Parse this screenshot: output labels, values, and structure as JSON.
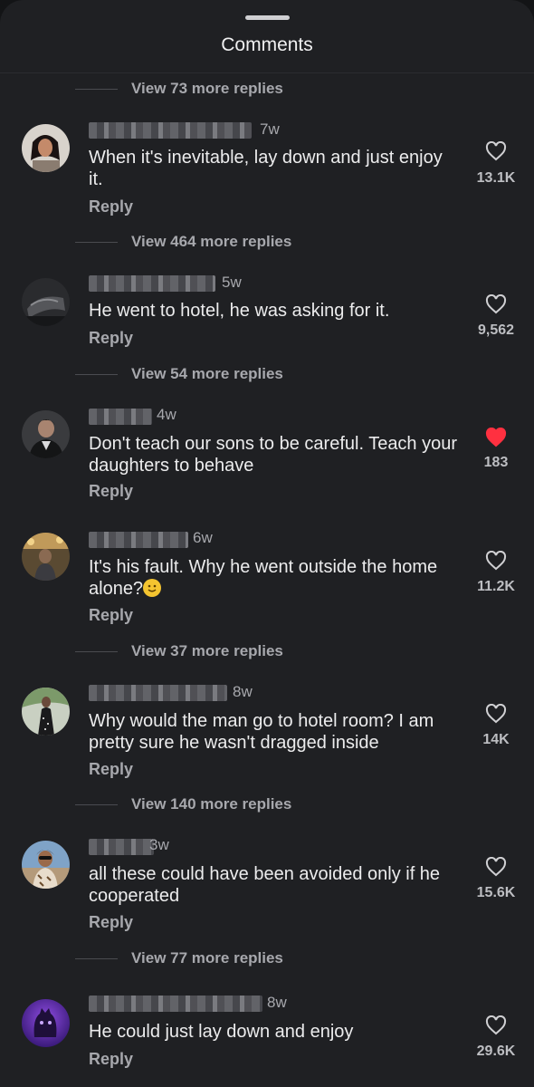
{
  "header": {
    "title": "Comments"
  },
  "replies": [
    "View 73 more replies",
    "View 464 more replies",
    "View 54 more replies",
    "View 37 more replies",
    "View 140 more replies",
    "View 77 more replies"
  ],
  "comments": [
    {
      "time": "7w",
      "text": "When it's inevitable, lay down and just enjoy it.",
      "reply": "Reply",
      "likes": "13.1K",
      "liked": false
    },
    {
      "time": "5w",
      "text": "He went to hotel, he was asking for it.",
      "reply": "Reply",
      "likes": "9,562",
      "liked": false
    },
    {
      "time": "4w",
      "text": "Don't teach our sons to be careful. Teach your daughters to behave",
      "reply": "Reply",
      "likes": "183",
      "liked": true
    },
    {
      "time": "6w",
      "text": "It's his fault. Why he went outside the home alone?",
      "reply": "Reply",
      "likes": "11.2K",
      "liked": false,
      "emoji": "slightly-smiling-face"
    },
    {
      "time": "8w",
      "text": "Why would the man go to hotel room? I am pretty sure he wasn't dragged inside",
      "reply": "Reply",
      "likes": "14K",
      "liked": false
    },
    {
      "time": "3w",
      "text": "all these could have been avoided only if he cooperated",
      "reply": "Reply",
      "likes": "15.6K",
      "liked": false
    },
    {
      "time": "8w",
      "text": "He could just lay down and enjoy",
      "reply": "Reply",
      "likes": "29.6K",
      "liked": false
    }
  ],
  "colors": {
    "background": "#1f2023",
    "heart_liked": "#ff3040",
    "muted_text": "#a7a8ad"
  },
  "icons": {
    "like": "heart-icon",
    "liked": "heart-filled-icon"
  }
}
